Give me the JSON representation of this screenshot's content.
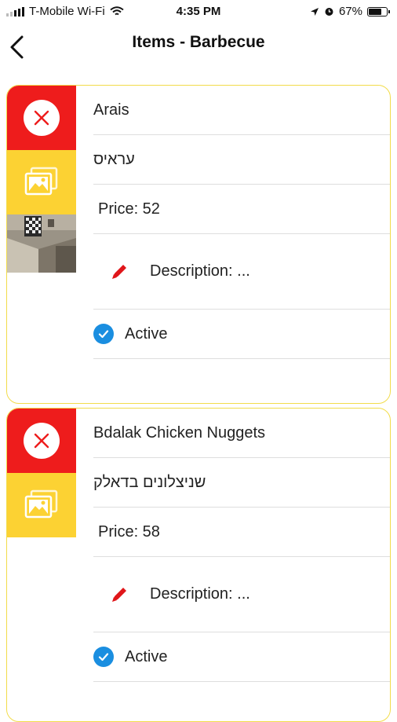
{
  "status_bar": {
    "carrier": "T-Mobile Wi-Fi",
    "time": "4:35 PM",
    "battery_percent": "67%",
    "icons": [
      "signal-icon",
      "wifi-icon",
      "location-icon",
      "alarm-icon",
      "battery-icon"
    ]
  },
  "nav": {
    "title": "Items - Barbecue",
    "back_icon": "chevron-left-icon"
  },
  "colors": {
    "delete_red": "#ee1c1c",
    "image_yellow": "#fcd233",
    "card_border": "#f2dc4a",
    "edit_red": "#e0161a",
    "active_blue": "#1a8ee0"
  },
  "items": [
    {
      "name": "Arais",
      "hebrew_name": "עראיס",
      "price": "Price: 52",
      "description": "Description: ...",
      "status": "Active",
      "has_photo": true
    },
    {
      "name": "Bdalak Chicken Nuggets",
      "hebrew_name": "שניצלונים בדאלק",
      "price": "Price: 58",
      "description": "Description: ...",
      "status": "Active",
      "has_photo": false
    }
  ]
}
